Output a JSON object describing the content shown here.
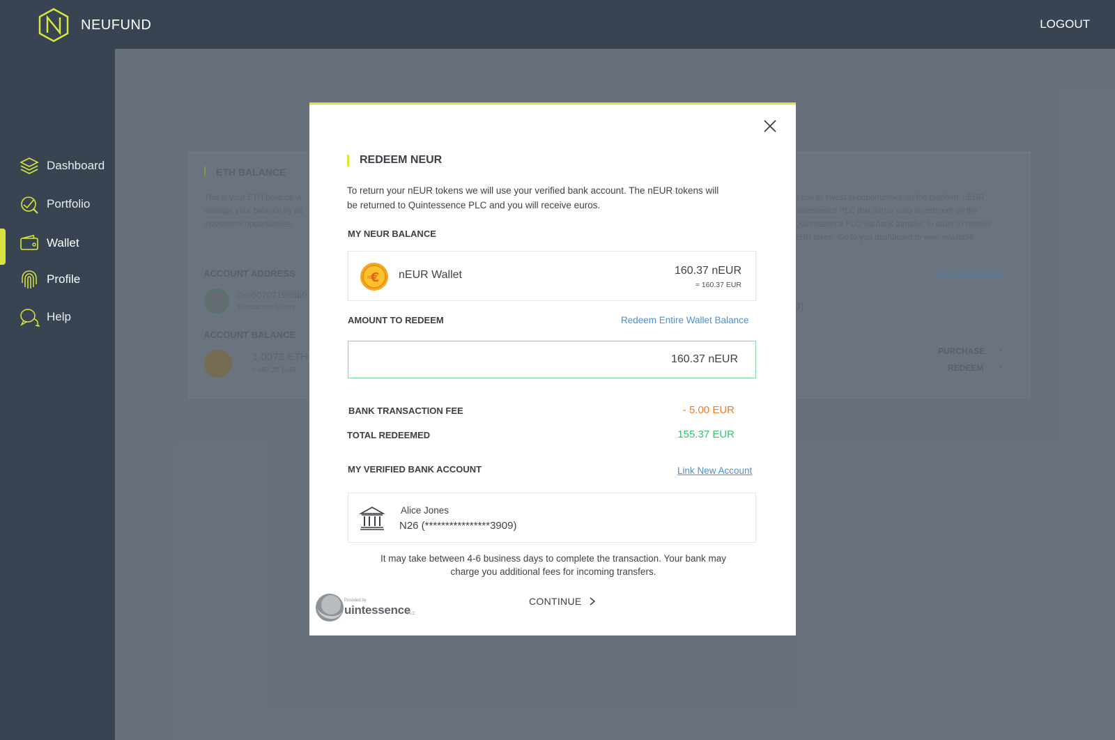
{
  "app": {
    "brand": "NEUFUND",
    "logout_label": "LOGOUT"
  },
  "sidebar": {
    "items": [
      {
        "label": "Dashboard",
        "icon": "layers-icon"
      },
      {
        "label": "Portfolio",
        "icon": "portfolio-chart-icon"
      },
      {
        "label": "Wallet",
        "icon": "wallet-icon",
        "active": true
      },
      {
        "label": "Profile",
        "icon": "fingerprint-icon"
      },
      {
        "label": "Help",
        "icon": "chat-bubbles-icon"
      }
    ]
  },
  "background": {
    "eth_balance_title": "ETH BALANCE",
    "eth_desc_1": "This is your ETH balance w",
    "eth_desc_2": "manage your balance by ad",
    "eth_desc_3": "investment opportunities.",
    "account_address_label": "ACCOUNT ADDRESS",
    "address_value": "0xe007071966b9",
    "address_sub": "Transaction history",
    "account_balance_label": "ACCOUNT BALANCE",
    "eth_amount": "1.0073 ETH",
    "eth_eur": "≈ 487.20 EUR",
    "right_desc_1": "u use to invest in opportunities on the platform. nEUR",
    "right_desc_2": "uintessence PLC that mirror euro investment on the",
    "right_desc_3": "Quintessence PLC via bank transfer. In order to receive",
    "right_desc_4": "EUR token. Go to you dashboard to view available",
    "link_new_account": "Link New Account",
    "bank_fragment": "9)",
    "purchase_label": "PURCHASE",
    "redeem_label": "REDEEM"
  },
  "modal": {
    "title": "REDEEM NEUR",
    "description": "To return your nEUR tokens we will use your verified bank account. The nEUR tokens will be returned to Quintessence PLC and you will receive euros.",
    "balance_label": "MY NEUR BALANCE",
    "wallet_name": "nEUR Wallet",
    "wallet_balance": "160.37 nEUR",
    "wallet_balance_eur": "≈ 160.37 EUR",
    "amount_label": "AMOUNT TO REDEEM",
    "redeem_entire_link": "Redeem Entire Wallet Balance",
    "amount_value": "160.37 nEUR",
    "fee_label": "BANK TRANSACTION FEE",
    "fee_value": "- 5.00 EUR",
    "total_label": "TOTAL REDEEMED",
    "total_value": "155.37 EUR",
    "bank_label": "MY VERIFIED BANK ACCOUNT",
    "link_new_account": "Link New Account",
    "bank_holder": "Alice Jones",
    "bank_account": "N26 (****************3909)",
    "note": "It may take between 4-6 business days to complete the transaction. Your bank may charge you additional fees for incoming transfers.",
    "continue_label": "CONTINUE",
    "provider_small": "Provided by",
    "provider_name": "uintessence",
    "provider_suffix": "PLC"
  },
  "colors": {
    "accent": "#d9e63c",
    "nav_bg": "#394452",
    "fee_orange": "#f07a22",
    "total_green": "#38c172",
    "link_blue": "#4a8fd4",
    "input_border": "#7fd6a4"
  }
}
